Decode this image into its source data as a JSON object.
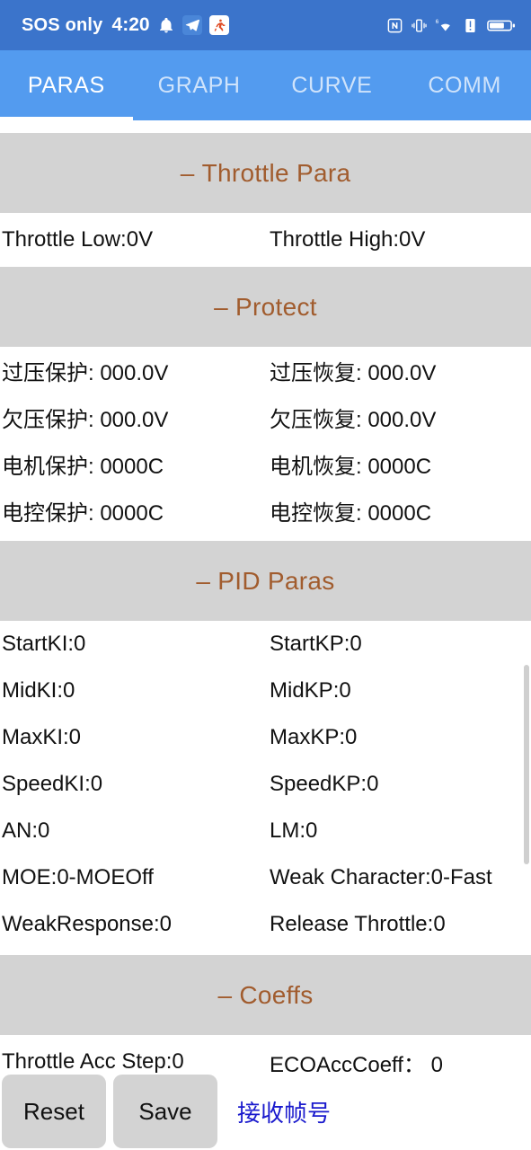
{
  "status_bar": {
    "carrier": "SOS only",
    "time": "4:20",
    "left_icons": [
      "notification-bell-icon",
      "telegram-app-icon",
      "running-app-icon"
    ],
    "right_icons": [
      "nfc-icon",
      "vibrate-icon",
      "wifi-6-icon",
      "alert-icon",
      "battery-icon"
    ],
    "background": "#3B74CB"
  },
  "tabs": {
    "items": [
      {
        "label": "PARAS",
        "active": true
      },
      {
        "label": "GRAPH",
        "active": false
      },
      {
        "label": "CURVE",
        "active": false
      },
      {
        "label": "COMM",
        "active": false
      }
    ],
    "background": "#539BEF",
    "indicator_color": "#FFFFFF"
  },
  "clipped_top_row": {
    "left": "",
    "right": ""
  },
  "header_color": "#A15C2E",
  "header_background": "#D3D3D3",
  "sections": [
    {
      "title": "Throttle Para",
      "dash": "–",
      "rows": [
        {
          "left": "Throttle Low:0V",
          "right": "Throttle High:0V"
        }
      ]
    },
    {
      "title": "Protect",
      "dash": "–",
      "rows": [
        {
          "left": "过压保护: 000.0V",
          "right": "过压恢复: 000.0V"
        },
        {
          "left": "欠压保护: 000.0V",
          "right": "欠压恢复: 000.0V"
        },
        {
          "left": "电机保护: 0000C",
          "right": "电机恢复: 0000C"
        },
        {
          "left": "电控保护: 0000C",
          "right": "电控恢复: 0000C"
        }
      ]
    },
    {
      "title": "PID Paras",
      "dash": "–",
      "rows": [
        {
          "left": "StartKI:0",
          "right": "StartKP:0"
        },
        {
          "left": "MidKI:0",
          "right": "MidKP:0"
        },
        {
          "left": "MaxKI:0",
          "right": "MaxKP:0"
        },
        {
          "left": "SpeedKI:0",
          "right": "SpeedKP:0"
        },
        {
          "left": "AN:0",
          "right": "LM:0"
        },
        {
          "left": "MOE:0-MOEOff",
          "right": "Weak Character:0-Fast"
        },
        {
          "left": "WeakResponse:0",
          "right": "Release Throttle:0"
        }
      ]
    },
    {
      "title": "Coeffs",
      "dash": "–",
      "rows": [
        {
          "left": "Throttle Acc Step:0",
          "right": "ECOAccCoeff： 0"
        }
      ]
    }
  ],
  "bottom_bar": {
    "reset_label": "Reset",
    "save_label": "Save",
    "link_label": "接收帧号",
    "link_color": "#1A1ACD"
  }
}
